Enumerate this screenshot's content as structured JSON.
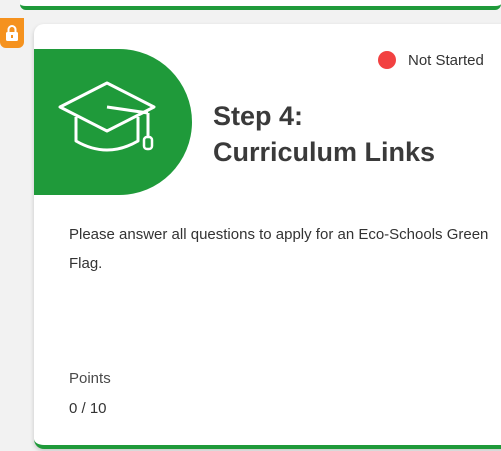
{
  "card": {
    "status": "Not Started",
    "title_line1": "Step 4:",
    "title_line2": "Curriculum Links",
    "description": "Please answer all questions to apply for an Eco-Schools Green Flag.",
    "points_label": "Points",
    "points_value": "0 / 10"
  },
  "icons": {
    "hero": "graduation-cap-icon",
    "badge": "lock-icon",
    "status": "status-dot-icon"
  },
  "colors": {
    "accent_green": "#1f9a3a",
    "lock_orange": "#f5921e",
    "status_red": "#f24141"
  }
}
